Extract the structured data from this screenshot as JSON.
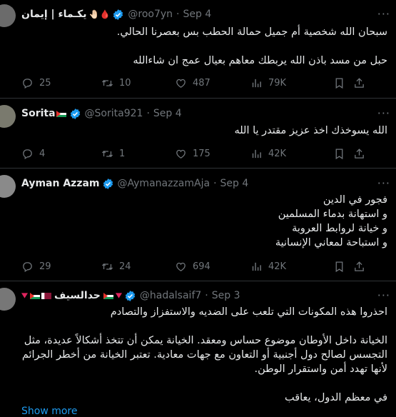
{
  "tweets": [
    {
      "display_name": "يكـماء | إيمان",
      "name_emoji": "🤚🏻🩸",
      "handle": "@roo7yn",
      "sep": "·",
      "date": "Sep 4",
      "verified": true,
      "lines": [
        "سبحان الله شخصية أم جميل حمالة الحطب بس بعصرنا الحالي.",
        "",
        "حبل من مسد باذن الله يربطك معاهم بعيال عمج ان شاءالله"
      ],
      "replies": "25",
      "retweets": "10",
      "likes": "487",
      "views": "79K"
    },
    {
      "display_name": "Sorita",
      "name_emoji": "🇵🇸",
      "handle": "@Sorita921",
      "sep": "·",
      "date": "Sep 4",
      "verified": true,
      "lines": [
        "الله يسوخذك اخذ عزيز مقتدر يا الله"
      ],
      "replies": "4",
      "retweets": "1",
      "likes": "175",
      "views": "42K"
    },
    {
      "display_name": "Ayman Azzam",
      "handle": "@AymanazzamAja",
      "sep": "·",
      "date": "Sep 4",
      "verified": true,
      "lines": [
        "فجور في الدين",
        "و  استهانة بدماء المسلمين",
        "و خيانة لروابط العروبة",
        "و استباحة لمعاني الإنسانية"
      ],
      "replies": "29",
      "retweets": "24",
      "likes": "694",
      "views": "42K"
    },
    {
      "display_name": "حدالسيف",
      "handle": "@hadalsaif7",
      "sep": "·",
      "date": "Sep 3",
      "verified": true,
      "lines": [
        "احذروا هذه المكونات التي تلعب على الضديه والاستفزاز والتصادم",
        "",
        "الخيانة داخل الأوطان موضوع حساس ومعقد. الخيانة يمكن أن تتخذ أشكالاً عديدة، مثل",
        "التجسس لصالح دول أجنبية أو التعاون مع جهات معادية. تعتبر الخيانة من أخطر الجرائم",
        "لأنها تهدد أمن واستقرار الوطن.",
        "",
        "في معظم الدول، يعاقب"
      ],
      "show_more": "Show more"
    }
  ],
  "icons": {
    "reply": "reply-icon",
    "retweet": "retweet-icon",
    "like": "heart-icon",
    "views": "views-icon",
    "bookmark": "bookmark-icon",
    "share": "share-icon",
    "more": "more-icon",
    "verified": "verified-badge-icon"
  },
  "colors": {
    "background": "#000000",
    "text": "#e7e9ea",
    "muted": "#71767b",
    "link": "#1d9bf0",
    "verified": "#1d9bf0",
    "divider": "#2f3336"
  }
}
